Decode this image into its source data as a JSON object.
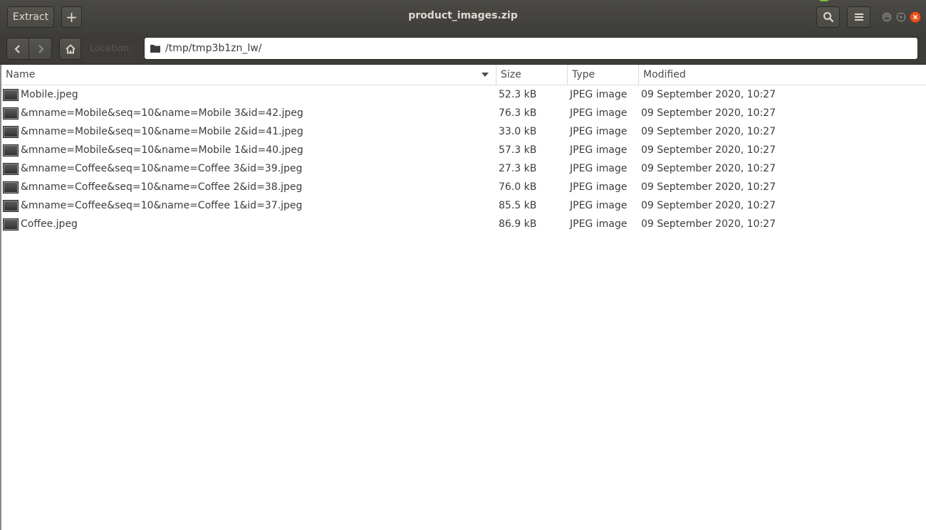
{
  "header": {
    "title": "product_images.zip",
    "extract_label": "Extract",
    "add_label": "+"
  },
  "location": {
    "label": "Location:",
    "path": "/tmp/tmp3b1zn_lw/"
  },
  "columns": {
    "name": "Name",
    "size": "Size",
    "type": "Type",
    "modified": "Modified"
  },
  "files": [
    {
      "name": "Mobile.jpeg",
      "size": "52.3 kB",
      "type": "JPEG image",
      "modified": "09 September 2020, 10:27"
    },
    {
      "name": "&mname=Mobile&seq=10&name=Mobile 3&id=42.jpeg",
      "size": "76.3 kB",
      "type": "JPEG image",
      "modified": "09 September 2020, 10:27"
    },
    {
      "name": "&mname=Mobile&seq=10&name=Mobile 2&id=41.jpeg",
      "size": "33.0 kB",
      "type": "JPEG image",
      "modified": "09 September 2020, 10:27"
    },
    {
      "name": "&mname=Mobile&seq=10&name=Mobile 1&id=40.jpeg",
      "size": "57.3 kB",
      "type": "JPEG image",
      "modified": "09 September 2020, 10:27"
    },
    {
      "name": "&mname=Coffee&seq=10&name=Coffee 3&id=39.jpeg",
      "size": "27.3 kB",
      "type": "JPEG image",
      "modified": "09 September 2020, 10:27"
    },
    {
      "name": "&mname=Coffee&seq=10&name=Coffee 2&id=38.jpeg",
      "size": "76.0 kB",
      "type": "JPEG image",
      "modified": "09 September 2020, 10:27"
    },
    {
      "name": "&mname=Coffee&seq=10&name=Coffee 1&id=37.jpeg",
      "size": "85.5 kB",
      "type": "JPEG image",
      "modified": "09 September 2020, 10:27"
    },
    {
      "name": "Coffee.jpeg",
      "size": "86.9 kB",
      "type": "JPEG image",
      "modified": "09 September 2020, 10:27"
    }
  ],
  "colors": {
    "headerbar": "#3f3e3a",
    "close_button": "#e95420"
  }
}
